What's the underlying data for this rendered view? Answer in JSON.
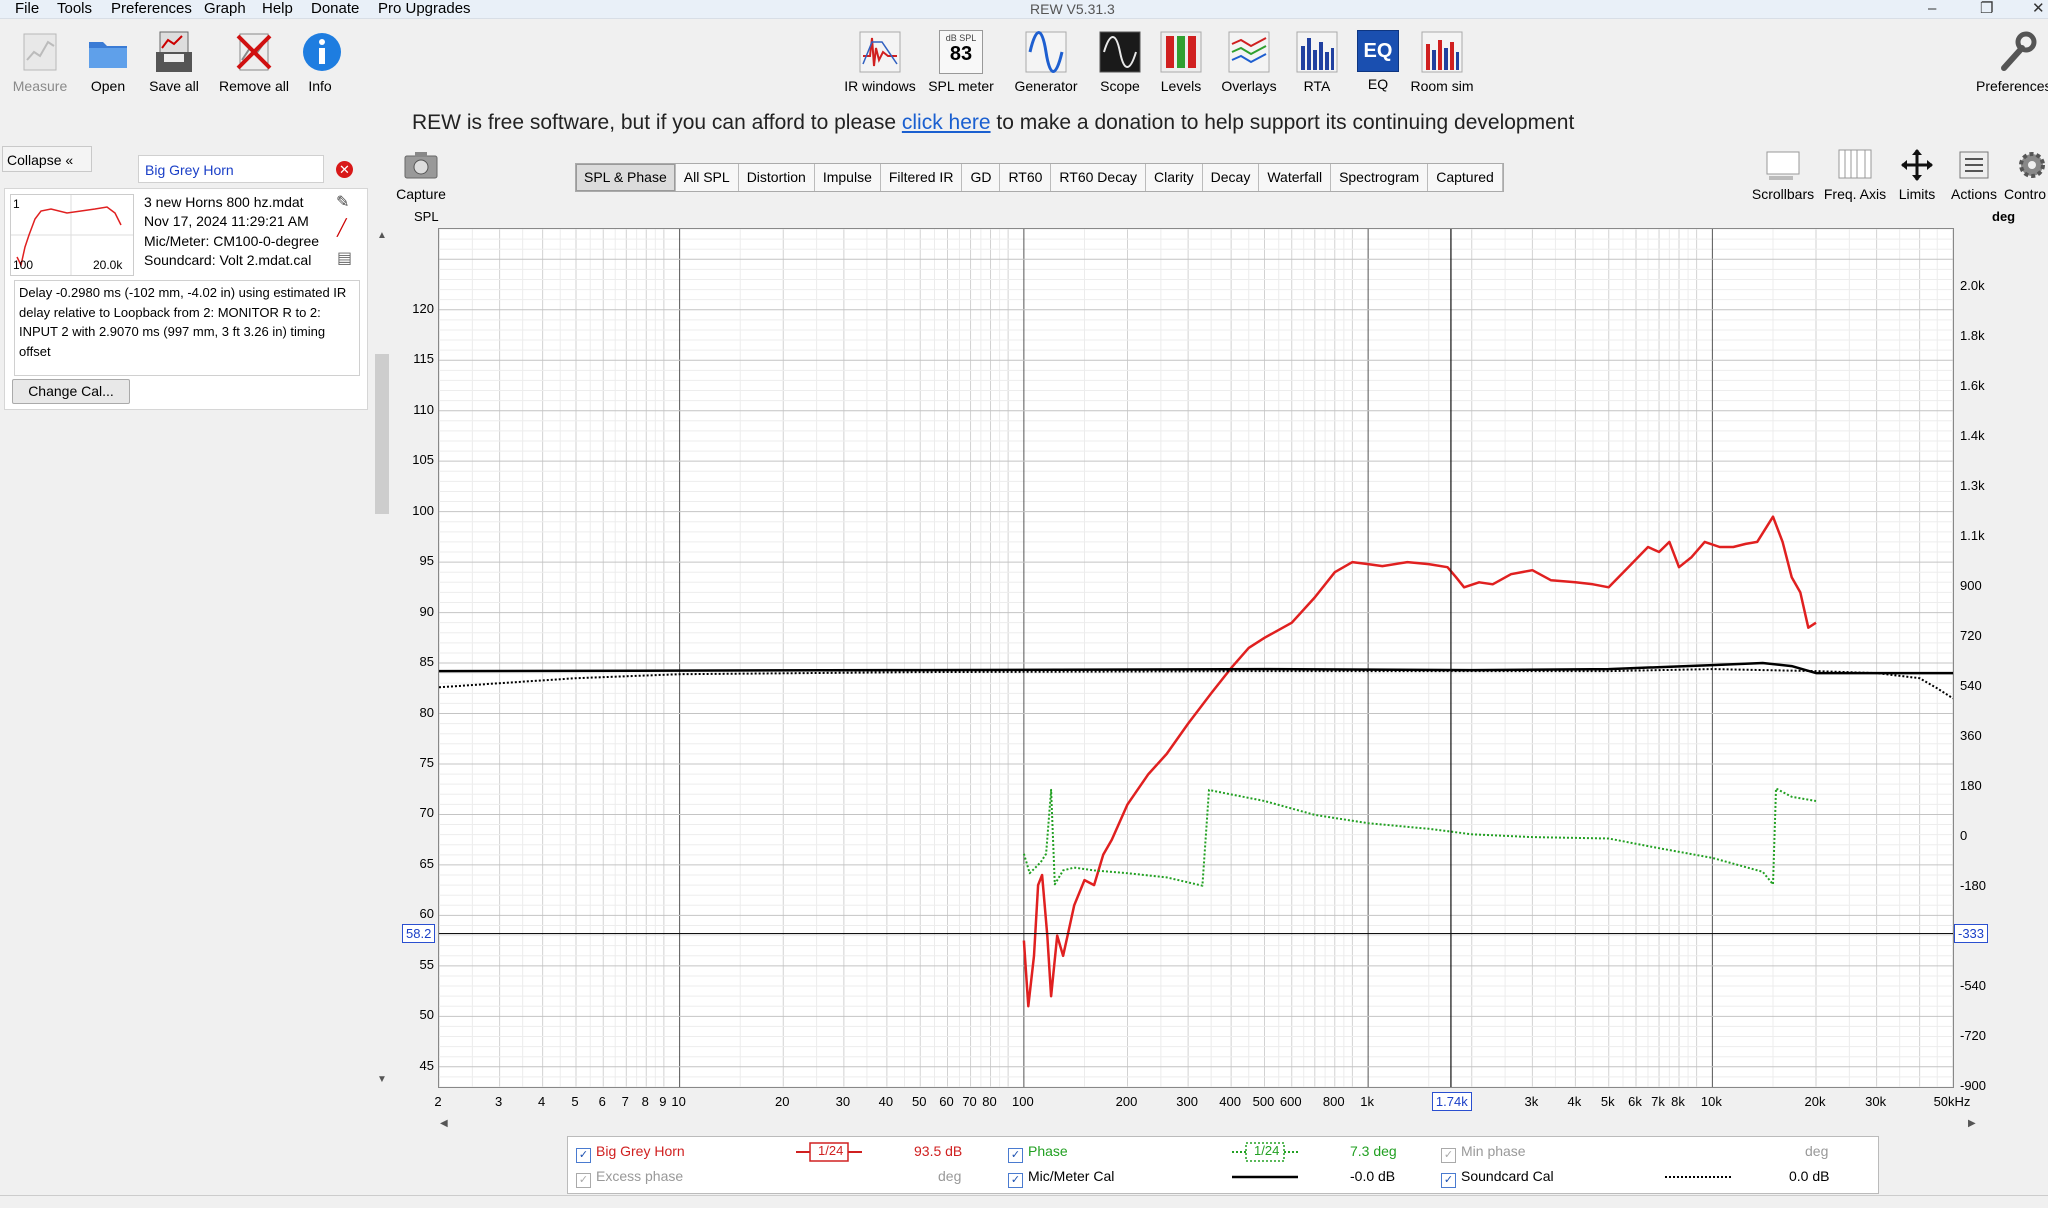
{
  "menu": [
    "File",
    "Tools",
    "Preferences",
    "Graph",
    "Help",
    "Donate",
    "Pro Upgrades"
  ],
  "window_title": "REW V5.31.3",
  "window_controls": {
    "minimize": "–",
    "maximize": "❐",
    "close": "✕"
  },
  "toolbar_left": [
    {
      "label": "Measure",
      "enabled": false
    },
    {
      "label": "Open",
      "enabled": true
    },
    {
      "label": "Save all",
      "enabled": true
    },
    {
      "label": "Remove all",
      "enabled": true
    },
    {
      "label": "Info",
      "enabled": true
    }
  ],
  "toolbar_center": [
    "IR windows",
    "SPL meter",
    "Generator",
    "Scope",
    "Levels",
    "Overlays",
    "RTA",
    "EQ",
    "Room sim"
  ],
  "spl_meter_top": "dB SPL",
  "spl_meter_value": "83",
  "toolbar_right": [
    "Preferences"
  ],
  "donate": {
    "pre": "REW is free software, but if you can afford to please ",
    "link": "click here",
    "post": " to make a donation to help support its continuing development"
  },
  "left_panel": {
    "collapse_label": "Collapse",
    "measurement_name": "Big Grey Horn",
    "measurement_index": "1",
    "thumb_x_min": "100",
    "thumb_x_max": "20.0k",
    "info_lines": [
      "3 new Horns 800 hz.mdat",
      "Nov 17, 2024 11:29:21 AM",
      "Mic/Meter: CM100-0-degree",
      "Soundcard: Volt 2.mdat.cal"
    ],
    "delay_text": "Delay -0.2980 ms (-102 mm, -4.02 in) using estimated IR delay relative to Loopback from 2: MONITOR R to 2: INPUT 2 with 2.9070 ms (997 mm, 3 ft 3.26 in) timing offset",
    "change_cal_label": "Change Cal..."
  },
  "capture_label": "Capture",
  "tabs": [
    {
      "label": "SPL & Phase",
      "active": true
    },
    {
      "label": "All SPL"
    },
    {
      "label": "Distortion"
    },
    {
      "label": "Impulse"
    },
    {
      "label": "Filtered IR"
    },
    {
      "label": "GD"
    },
    {
      "label": "RT60"
    },
    {
      "label": "RT60 Decay"
    },
    {
      "label": "Clarity"
    },
    {
      "label": "Decay"
    },
    {
      "label": "Waterfall"
    },
    {
      "label": "Spectrogram"
    },
    {
      "label": "Captured"
    }
  ],
  "graph_controls": [
    "Scrollbars",
    "Freq. Axis",
    "Limits",
    "Actions",
    "Contro"
  ],
  "chart_data": {
    "type": "line",
    "ylabel": "SPL",
    "y2label": "deg",
    "x_scale": "log",
    "xlim": [
      2,
      50000
    ],
    "ylim": [
      43,
      128
    ],
    "y2lim": [
      -900,
      2190
    ],
    "y_ticks": [
      45,
      50,
      55,
      60,
      65,
      70,
      75,
      80,
      85,
      90,
      95,
      100,
      105,
      110,
      115,
      120
    ],
    "y2_ticks": [
      {
        "v": -900,
        "label": "-900"
      },
      {
        "v": -720,
        "label": "-720"
      },
      {
        "v": -540,
        "label": "-540"
      },
      {
        "v": -360,
        "label": "-360"
      },
      {
        "v": -180,
        "label": "-180"
      },
      {
        "v": 0,
        "label": "0"
      },
      {
        "v": 180,
        "label": "180"
      },
      {
        "v": 360,
        "label": "360"
      },
      {
        "v": 540,
        "label": "540"
      },
      {
        "v": 720,
        "label": "720"
      },
      {
        "v": 900,
        "label": "900"
      },
      {
        "v": 1080,
        "label": "1.1k"
      },
      {
        "v": 1260,
        "label": "1.3k"
      },
      {
        "v": 1440,
        "label": "1.4k"
      },
      {
        "v": 1620,
        "label": "1.6k"
      },
      {
        "v": 1800,
        "label": "1.8k"
      },
      {
        "v": 1980,
        "label": "2.0k"
      }
    ],
    "x_ticks": [
      {
        "v": 2,
        "label": "2"
      },
      {
        "v": 3,
        "label": "3"
      },
      {
        "v": 4,
        "label": "4"
      },
      {
        "v": 5,
        "label": "5"
      },
      {
        "v": 6,
        "label": "6"
      },
      {
        "v": 7,
        "label": "7"
      },
      {
        "v": 8,
        "label": "8"
      },
      {
        "v": 9,
        "label": "9"
      },
      {
        "v": 10,
        "label": "10"
      },
      {
        "v": 20,
        "label": "20"
      },
      {
        "v": 30,
        "label": "30"
      },
      {
        "v": 40,
        "label": "40"
      },
      {
        "v": 50,
        "label": "50"
      },
      {
        "v": 60,
        "label": "60"
      },
      {
        "v": 70,
        "label": "70"
      },
      {
        "v": 80,
        "label": "80"
      },
      {
        "v": 100,
        "label": "100"
      },
      {
        "v": 200,
        "label": "200"
      },
      {
        "v": 300,
        "label": "300"
      },
      {
        "v": 400,
        "label": "400"
      },
      {
        "v": 500,
        "label": "500"
      },
      {
        "v": 600,
        "label": "600"
      },
      {
        "v": 800,
        "label": "800"
      },
      {
        "v": 1000,
        "label": "1k"
      },
      {
        "v": 3000,
        "label": "3k"
      },
      {
        "v": 4000,
        "label": "4k"
      },
      {
        "v": 5000,
        "label": "5k"
      },
      {
        "v": 6000,
        "label": "6k"
      },
      {
        "v": 7000,
        "label": "7k"
      },
      {
        "v": 8000,
        "label": "8k"
      },
      {
        "v": 10000,
        "label": "10k"
      },
      {
        "v": 20000,
        "label": "20k"
      },
      {
        "v": 30000,
        "label": "30k"
      },
      {
        "v": 50000,
        "label": "50kHz"
      }
    ],
    "cursor": {
      "freq_label": "1.74k",
      "spl_label": "58.2",
      "phase_label": "-333",
      "freq": 1740,
      "spl": 58.2
    },
    "series": [
      {
        "name": "Big Grey Horn",
        "color": "#e02020",
        "style": "solid",
        "axis": "left",
        "points": [
          [
            100,
            57.5
          ],
          [
            103,
            51
          ],
          [
            107,
            56
          ],
          [
            110,
            63
          ],
          [
            113,
            64
          ],
          [
            117,
            58
          ],
          [
            120,
            52
          ],
          [
            125,
            58
          ],
          [
            130,
            56
          ],
          [
            135,
            58.5
          ],
          [
            140,
            61
          ],
          [
            150,
            63.5
          ],
          [
            160,
            63
          ],
          [
            170,
            66
          ],
          [
            180,
            67.5
          ],
          [
            200,
            71
          ],
          [
            230,
            74
          ],
          [
            260,
            76
          ],
          [
            300,
            79
          ],
          [
            350,
            82
          ],
          [
            400,
            84.5
          ],
          [
            450,
            86.5
          ],
          [
            500,
            87.5
          ],
          [
            600,
            89
          ],
          [
            700,
            91.5
          ],
          [
            800,
            94
          ],
          [
            900,
            95
          ],
          [
            1000,
            94.8
          ],
          [
            1100,
            94.6
          ],
          [
            1300,
            95
          ],
          [
            1500,
            94.8
          ],
          [
            1700,
            94.5
          ],
          [
            1800,
            93.5
          ],
          [
            1900,
            92.5
          ],
          [
            2100,
            93
          ],
          [
            2300,
            92.8
          ],
          [
            2600,
            93.8
          ],
          [
            3000,
            94.2
          ],
          [
            3400,
            93.2
          ],
          [
            4000,
            93
          ],
          [
            4500,
            92.8
          ],
          [
            5000,
            92.5
          ],
          [
            5700,
            94.5
          ],
          [
            6500,
            96.5
          ],
          [
            7000,
            96
          ],
          [
            7500,
            97
          ],
          [
            8000,
            94.5
          ],
          [
            8700,
            95.5
          ],
          [
            9500,
            97
          ],
          [
            10500,
            96.5
          ],
          [
            11500,
            96.5
          ],
          [
            12500,
            96.8
          ],
          [
            13500,
            97
          ],
          [
            15000,
            99.5
          ],
          [
            16000,
            97
          ],
          [
            17000,
            93.5
          ],
          [
            18000,
            92
          ],
          [
            19000,
            88.5
          ],
          [
            20000,
            89
          ]
        ]
      },
      {
        "name": "Phase",
        "color": "#22a022",
        "style": "dotted",
        "axis": "right",
        "points": [
          [
            100,
            -60
          ],
          [
            104,
            -130
          ],
          [
            108,
            -110
          ],
          [
            112,
            -90
          ],
          [
            116,
            -60
          ],
          [
            120,
            170
          ],
          [
            123,
            -170
          ],
          [
            130,
            -120
          ],
          [
            140,
            -110
          ],
          [
            160,
            -120
          ],
          [
            200,
            -130
          ],
          [
            260,
            -145
          ],
          [
            330,
            -175
          ],
          [
            345,
            170
          ],
          [
            360,
            165
          ],
          [
            500,
            130
          ],
          [
            700,
            80
          ],
          [
            1000,
            50
          ],
          [
            1500,
            30
          ],
          [
            2000,
            10
          ],
          [
            3000,
            0
          ],
          [
            5000,
            -5
          ],
          [
            7000,
            -40
          ],
          [
            10000,
            -75
          ],
          [
            14000,
            -125
          ],
          [
            15000,
            -170
          ],
          [
            15300,
            175
          ],
          [
            17000,
            145
          ],
          [
            20000,
            130
          ]
        ]
      },
      {
        "name": "Mic/Meter Cal",
        "color": "#000000",
        "style": "solid",
        "axis": "left",
        "points": [
          [
            2,
            84.2
          ],
          [
            50,
            84.3
          ],
          [
            500,
            84.4
          ],
          [
            2000,
            84.3
          ],
          [
            5000,
            84.4
          ],
          [
            10000,
            84.8
          ],
          [
            14000,
            85.0
          ],
          [
            17000,
            84.7
          ],
          [
            20000,
            84
          ],
          [
            50000,
            84
          ]
        ]
      },
      {
        "name": "Soundcard Cal",
        "color": "#000000",
        "style": "dotted",
        "axis": "left",
        "points": [
          [
            2,
            82.6
          ],
          [
            3,
            83
          ],
          [
            5,
            83.5
          ],
          [
            10,
            83.9
          ],
          [
            50,
            84.1
          ],
          [
            500,
            84.2
          ],
          [
            5000,
            84.2
          ],
          [
            10000,
            84.4
          ],
          [
            20000,
            84.2
          ],
          [
            30000,
            84
          ],
          [
            40000,
            83.5
          ],
          [
            45000,
            82.5
          ],
          [
            50000,
            81.5
          ]
        ]
      }
    ]
  },
  "legend": [
    {
      "label": "Big Grey Horn",
      "checked": true,
      "enabled": true,
      "smoothing": "1/24",
      "value": "93.5 dB",
      "color": "#e02020"
    },
    {
      "label": "Phase",
      "checked": true,
      "enabled": true,
      "smoothing": "1/24",
      "value": "7.3 deg",
      "color": "#22a022"
    },
    {
      "label": "Min phase",
      "checked": true,
      "enabled": false,
      "value": "deg"
    },
    {
      "label": "Excess phase",
      "checked": true,
      "enabled": false,
      "value": "deg"
    },
    {
      "label": "Mic/Meter Cal",
      "checked": true,
      "enabled": true,
      "value": "-0.0 dB"
    },
    {
      "label": "Soundcard Cal",
      "checked": true,
      "enabled": true,
      "value": "0.0 dB"
    }
  ]
}
